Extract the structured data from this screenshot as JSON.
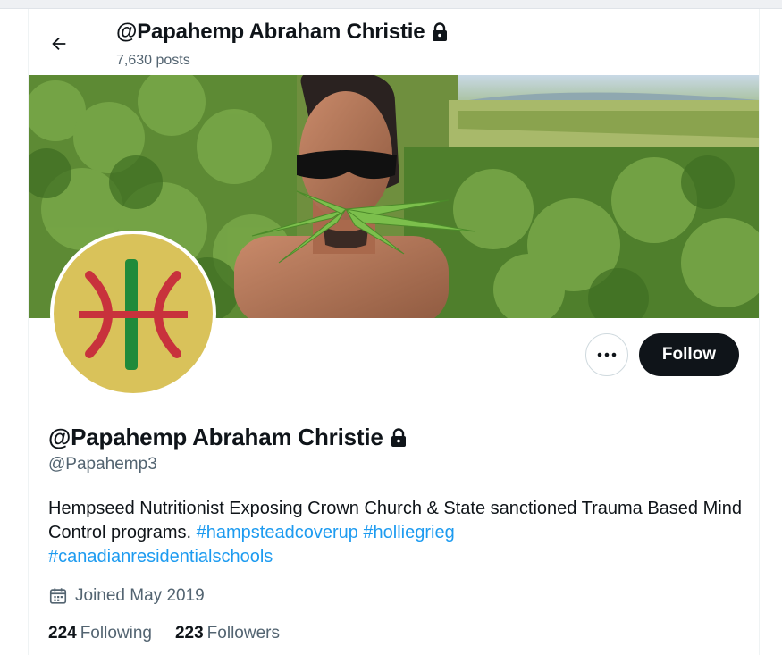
{
  "header": {
    "title": "@Papahemp Abraham Christie",
    "posts_count": "7,630 posts"
  },
  "profile": {
    "display_name": "@Papahemp Abraham Christie",
    "handle": "@Papahemp3",
    "bio_text": "Hempseed Nutritionist Exposing Crown Church & State sanctioned Trauma Based Mind Control programs. ",
    "hashtags": [
      "#hampsteadcoverup",
      "#holliegrieg",
      "#canadianresidentialschools"
    ],
    "joined": "Joined May 2019",
    "following_count": "224",
    "following_label": "Following",
    "followers_count": "223",
    "followers_label": "Followers"
  },
  "actions": {
    "follow_label": "Follow",
    "more_label": "•••"
  },
  "icons": {
    "back": "arrow-left-icon",
    "lock": "lock-icon",
    "calendar": "calendar-icon",
    "more": "more-horizontal-icon"
  },
  "colors": {
    "accent": "#1d9bf0",
    "text_primary": "#0f1419",
    "text_secondary": "#536471",
    "follow_bg": "#0f1419",
    "avatar_yellow": "#d9c25a",
    "avatar_red": "#c8323c",
    "avatar_green": "#1f8a3a"
  }
}
